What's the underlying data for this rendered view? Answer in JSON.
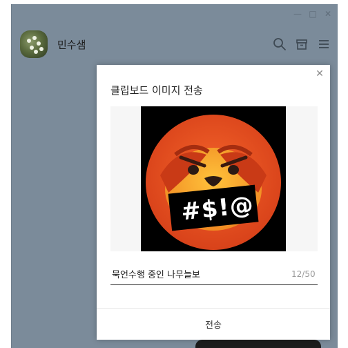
{
  "window": {
    "controls": {
      "minimize": "—",
      "maximize": "□",
      "close": "✕"
    }
  },
  "header": {
    "chat_name": "민수샘",
    "icons": [
      "search-icon",
      "archive-box-icon",
      "menu-icon"
    ]
  },
  "dialog": {
    "title": "클립보드 이미지 전송",
    "close": "✕",
    "image_text": "#$!@",
    "caption_value": "묵언수행 중인 나무늘보",
    "counter": "12/50",
    "send_label": "전송"
  },
  "colors": {
    "chat_background": "#7b8b9a",
    "emoji_orange": "#e8501c",
    "emoji_face": "#f7a62a"
  }
}
